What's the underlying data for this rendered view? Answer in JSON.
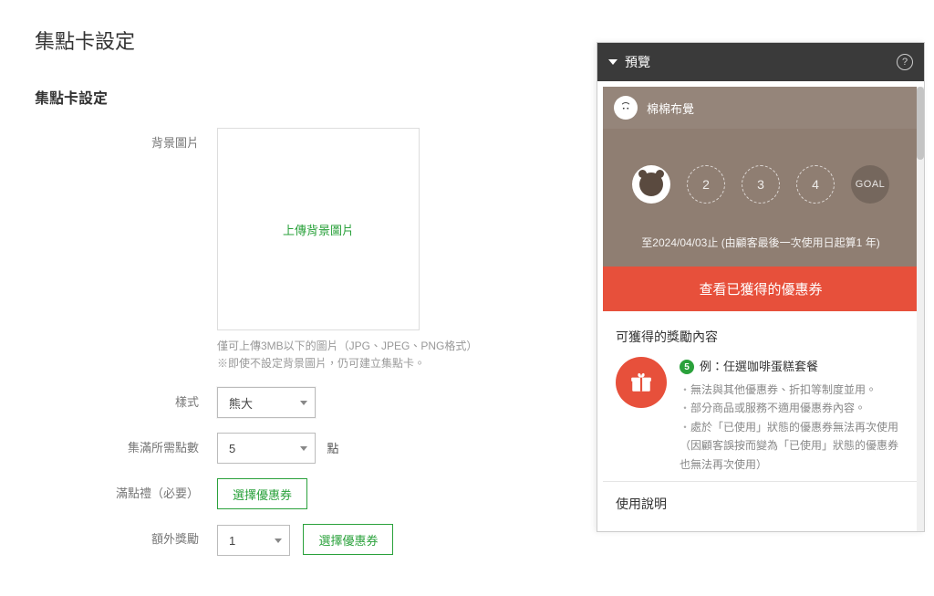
{
  "page": {
    "title": "集點卡設定",
    "section_title": "集點卡設定"
  },
  "form": {
    "bg_image_label": "背景圖片",
    "upload_text": "上傳背景圖片",
    "help_line1": "僅可上傳3MB以下的圖片（JPG、JPEG、PNG格式）",
    "help_line2": "※即使不設定背景圖片，仍可建立集點卡。",
    "style_label": "樣式",
    "style_value": "熊大",
    "points_label": "集滿所需點數",
    "points_value": "5",
    "points_unit": "點",
    "full_reward_label": "滿點禮",
    "required": "（必要）",
    "choose_coupon": "選擇優惠券",
    "extra_reward_label": "額外獎勵",
    "extra_reward_value": "1",
    "extra_choose_coupon": "選擇優惠券"
  },
  "preview": {
    "header_title": "預覽",
    "shop_name": "棉棉布覺",
    "stamps": {
      "s2": "2",
      "s3": "3",
      "s4": "4",
      "goal": "GOAL"
    },
    "expire": "至2024/04/03止 (由顧客最後一次使用日起算1 年)",
    "view_coupons": "查看已獲得的優惠券",
    "reward_title": "可獲得的獎勵內容",
    "reward_badge": "5",
    "reward_example_title": "例：任選咖啡蛋糕套餐",
    "reward_notes": [
      "無法與其他優惠券、折扣等制度並用。",
      "部分商品或服務不適用優惠券內容。",
      "處於「已使用」狀態的優惠券無法再次使用（因顧客誤按而變為「已使用」狀態的優惠券也無法再次使用）"
    ],
    "usage_title": "使用說明"
  }
}
